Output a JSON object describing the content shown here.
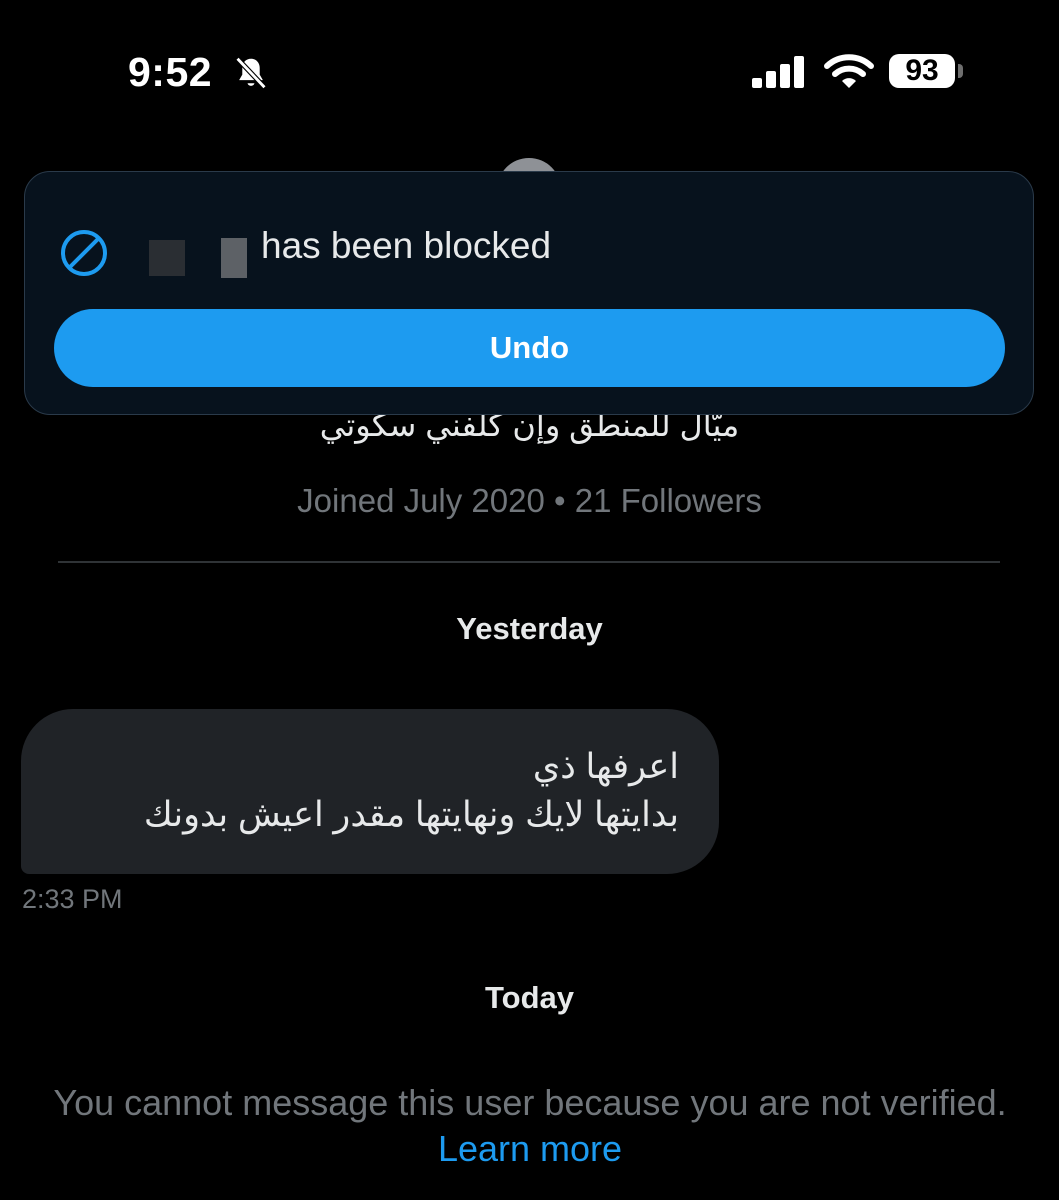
{
  "status_bar": {
    "time": "9:52",
    "battery": "93"
  },
  "toast": {
    "message": "has been blocked",
    "undo_label": "Undo"
  },
  "profile": {
    "bio": "ميّال للمنطق وإن كلفني سكوتي",
    "meta": "Joined July 2020 • 21 Followers"
  },
  "conversation": {
    "yesterday_label": "Yesterday",
    "message": {
      "line1": "اعرفها ذي",
      "line2": "بدايتها لايك ونهايتها مقدر اعيش بدونك",
      "time": "2:33 PM"
    },
    "today_label": "Today"
  },
  "notice": {
    "text": "You cannot message this user because you are not verified.",
    "link": "Learn more"
  },
  "colors": {
    "accent": "#1d9bf0",
    "background": "#000000",
    "bubble": "#202327",
    "muted": "#71767b"
  }
}
